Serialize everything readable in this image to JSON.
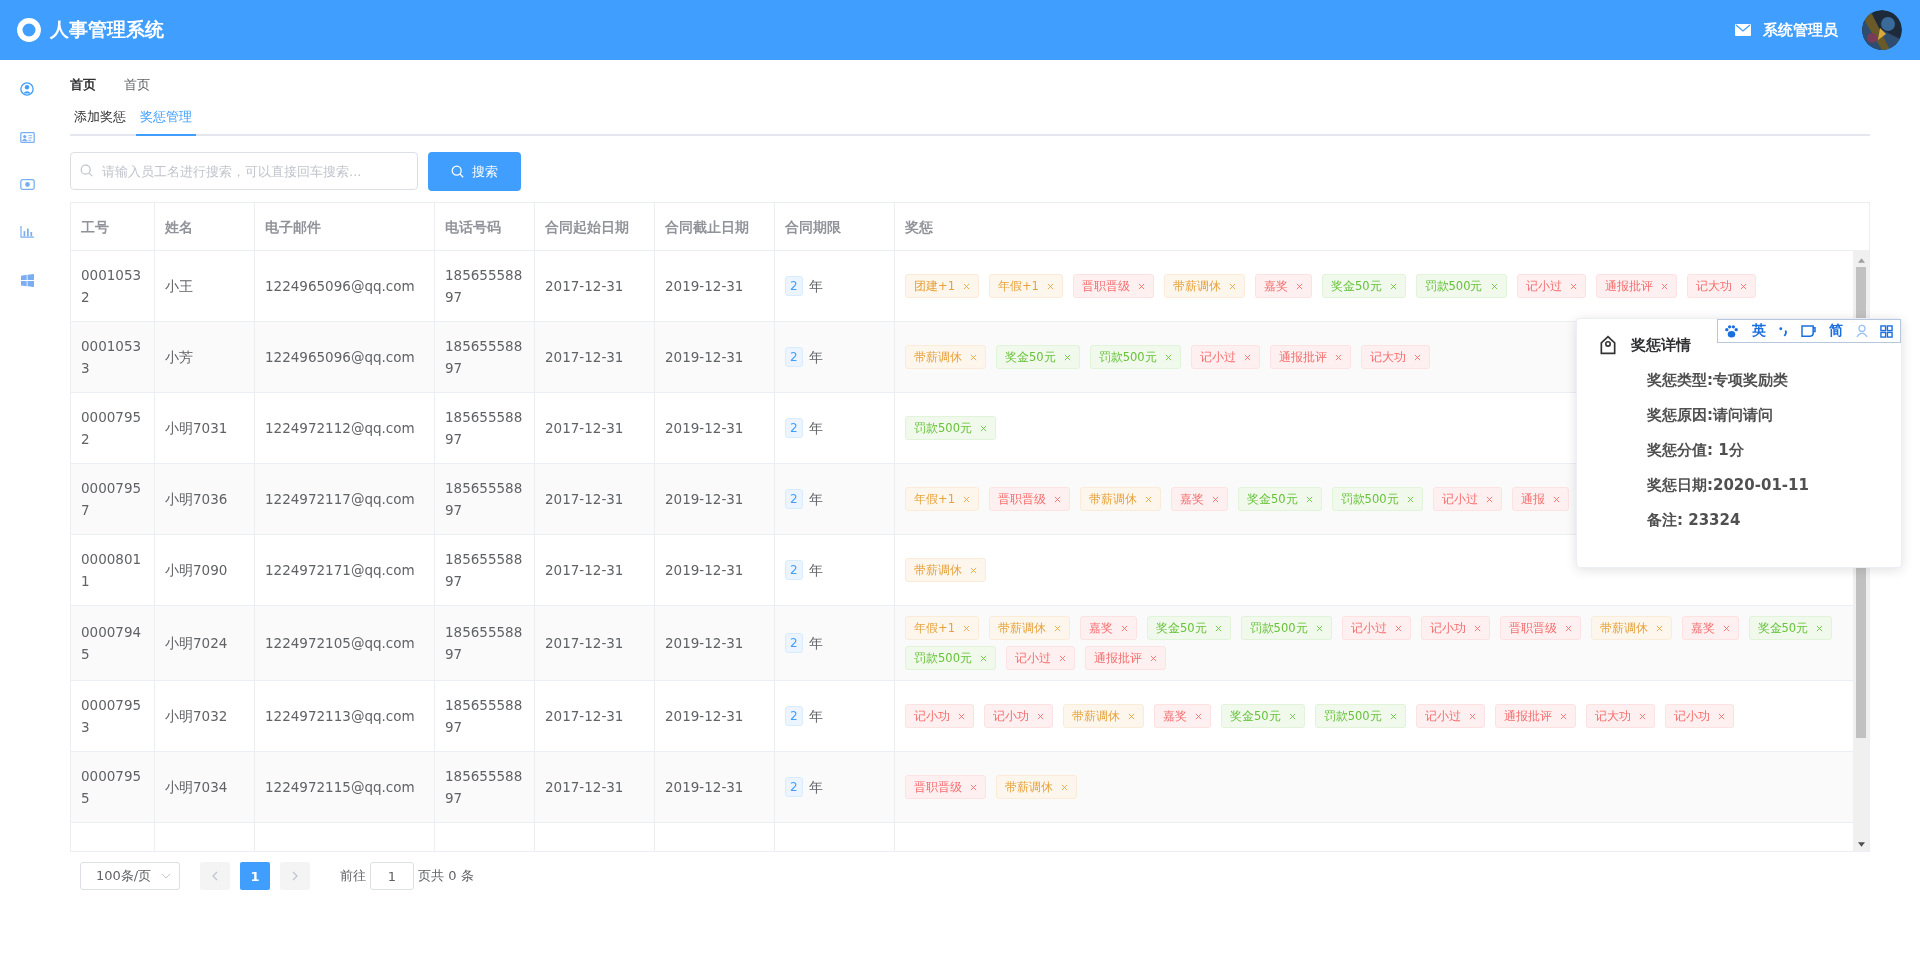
{
  "header": {
    "title": "人事管理系统",
    "user": "系统管理员"
  },
  "sidebar": {
    "items": [
      {
        "kind": "user",
        "selected": true
      },
      {
        "kind": "card",
        "selected": false
      },
      {
        "kind": "money",
        "selected": false
      },
      {
        "kind": "chart",
        "selected": false
      },
      {
        "kind": "windows",
        "selected": false
      }
    ]
  },
  "breadcrumb": [
    "首页",
    "首页"
  ],
  "tabs": [
    {
      "label": "添加奖惩",
      "selected": false
    },
    {
      "label": "奖惩管理",
      "selected": true
    }
  ],
  "search": {
    "placeholder": "请输入员工名进行搜索，可以直接回车搜索...",
    "button": "搜索"
  },
  "table": {
    "columns": [
      "工号",
      "姓名",
      "电子邮件",
      "电话号码",
      "合同起始日期",
      "合同截止日期",
      "合同期限",
      "奖惩"
    ],
    "rows": [
      {
        "id": "00010532",
        "name": "小王",
        "email": "1224965096@qq.com",
        "phone": "18565558897",
        "start": "2017-12-31",
        "end": "2019-12-31",
        "term": "2",
        "unit": "年",
        "tags": [
          {
            "label": "团建+1",
            "kind": "warning"
          },
          {
            "label": "年假+1",
            "kind": "warning"
          },
          {
            "label": "晋职晋级",
            "kind": "danger"
          },
          {
            "label": "带薪调休",
            "kind": "warning"
          },
          {
            "label": "嘉奖",
            "kind": "danger"
          },
          {
            "label": "奖金50元",
            "kind": "success"
          },
          {
            "label": "罚款500元",
            "kind": "success"
          },
          {
            "label": "记小过",
            "kind": "danger"
          },
          {
            "label": "通报批评",
            "kind": "danger"
          },
          {
            "label": "记大功",
            "kind": "danger"
          }
        ]
      },
      {
        "id": "00010533",
        "name": "小芳",
        "email": "1224965096@qq.com",
        "phone": "18565558897",
        "start": "2017-12-31",
        "end": "2019-12-31",
        "term": "2",
        "unit": "年",
        "tags": [
          {
            "label": "带薪调休",
            "kind": "warning"
          },
          {
            "label": "奖金50元",
            "kind": "success"
          },
          {
            "label": "罚款500元",
            "kind": "success"
          },
          {
            "label": "记小过",
            "kind": "danger"
          },
          {
            "label": "通报批评",
            "kind": "danger"
          },
          {
            "label": "记大功",
            "kind": "danger"
          }
        ]
      },
      {
        "id": "00007952",
        "name": "小明7031",
        "email": "1224972112@qq.com",
        "phone": "18565558897",
        "start": "2017-12-31",
        "end": "2019-12-31",
        "term": "2",
        "unit": "年",
        "tags": [
          {
            "label": "罚款500元",
            "kind": "success"
          }
        ]
      },
      {
        "id": "00007957",
        "name": "小明7036",
        "email": "1224972117@qq.com",
        "phone": "18565558897",
        "start": "2017-12-31",
        "end": "2019-12-31",
        "term": "2",
        "unit": "年",
        "tags": [
          {
            "label": "年假+1",
            "kind": "warning"
          },
          {
            "label": "晋职晋级",
            "kind": "danger"
          },
          {
            "label": "带薪调休",
            "kind": "warning"
          },
          {
            "label": "嘉奖",
            "kind": "danger"
          },
          {
            "label": "奖金50元",
            "kind": "success"
          },
          {
            "label": "罚款500元",
            "kind": "success"
          },
          {
            "label": "记小过",
            "kind": "danger"
          },
          {
            "label": "通报",
            "kind": "danger"
          }
        ]
      },
      {
        "id": "00008011",
        "name": "小明7090",
        "email": "1224972171@qq.com",
        "phone": "18565558897",
        "start": "2017-12-31",
        "end": "2019-12-31",
        "term": "2",
        "unit": "年",
        "tags": [
          {
            "label": "带薪调休",
            "kind": "warning"
          }
        ]
      },
      {
        "id": "00007945",
        "name": "小明7024",
        "email": "1224972105@qq.com",
        "phone": "18565558897",
        "start": "2017-12-31",
        "end": "2019-12-31",
        "term": "2",
        "unit": "年",
        "tags": [
          {
            "label": "年假+1",
            "kind": "warning"
          },
          {
            "label": "带薪调休",
            "kind": "warning"
          },
          {
            "label": "嘉奖",
            "kind": "danger"
          },
          {
            "label": "奖金50元",
            "kind": "success"
          },
          {
            "label": "罚款500元",
            "kind": "success"
          },
          {
            "label": "记小过",
            "kind": "danger"
          },
          {
            "label": "记小功",
            "kind": "danger"
          },
          {
            "label": "晋职晋级",
            "kind": "danger"
          },
          {
            "label": "带薪调休",
            "kind": "warning"
          },
          {
            "label": "嘉奖",
            "kind": "danger"
          },
          {
            "label": "奖金50元",
            "kind": "success"
          },
          {
            "label": "罚款500元",
            "kind": "success"
          },
          {
            "label": "记小过",
            "kind": "danger"
          },
          {
            "label": "通报批评",
            "kind": "danger"
          }
        ]
      },
      {
        "id": "00007953",
        "name": "小明7032",
        "email": "1224972113@qq.com",
        "phone": "18565558897",
        "start": "2017-12-31",
        "end": "2019-12-31",
        "term": "2",
        "unit": "年",
        "tags": [
          {
            "label": "记小功",
            "kind": "danger"
          },
          {
            "label": "记小功",
            "kind": "danger"
          },
          {
            "label": "带薪调休",
            "kind": "warning"
          },
          {
            "label": "嘉奖",
            "kind": "danger"
          },
          {
            "label": "奖金50元",
            "kind": "success"
          },
          {
            "label": "罚款500元",
            "kind": "success"
          },
          {
            "label": "记小过",
            "kind": "danger"
          },
          {
            "label": "通报批评",
            "kind": "danger"
          },
          {
            "label": "记大功",
            "kind": "danger"
          },
          {
            "label": "记小功",
            "kind": "danger"
          }
        ]
      },
      {
        "id": "00007955",
        "name": "小明7034",
        "email": "1224972115@qq.com",
        "phone": "18565558897",
        "start": "2017-12-31",
        "end": "2019-12-31",
        "term": "2",
        "unit": "年",
        "tags": [
          {
            "label": "晋职晋级",
            "kind": "danger"
          },
          {
            "label": "带薪调休",
            "kind": "warning"
          }
        ]
      }
    ]
  },
  "pagination": {
    "page_size": "100条/页",
    "pages": [
      {
        "label": "1",
        "selected": true
      }
    ],
    "goto_label": "前往",
    "goto_value": "1",
    "total": "页共 0 条"
  },
  "popover": {
    "title": "奖惩详情",
    "lines": [
      "奖惩类型:专项奖励类",
      "奖惩原因:请问请问",
      "奖惩分值: 1分",
      "奖惩日期:2020-01-11",
      "备注: 23324"
    ]
  },
  "ime_toolbar": {
    "items": [
      {
        "kind": "paw"
      },
      {
        "kind": "text",
        "label": "英"
      },
      {
        "kind": "punct"
      },
      {
        "kind": "cup"
      },
      {
        "kind": "text",
        "label": "简"
      },
      {
        "kind": "user"
      },
      {
        "kind": "grid"
      }
    ]
  }
}
